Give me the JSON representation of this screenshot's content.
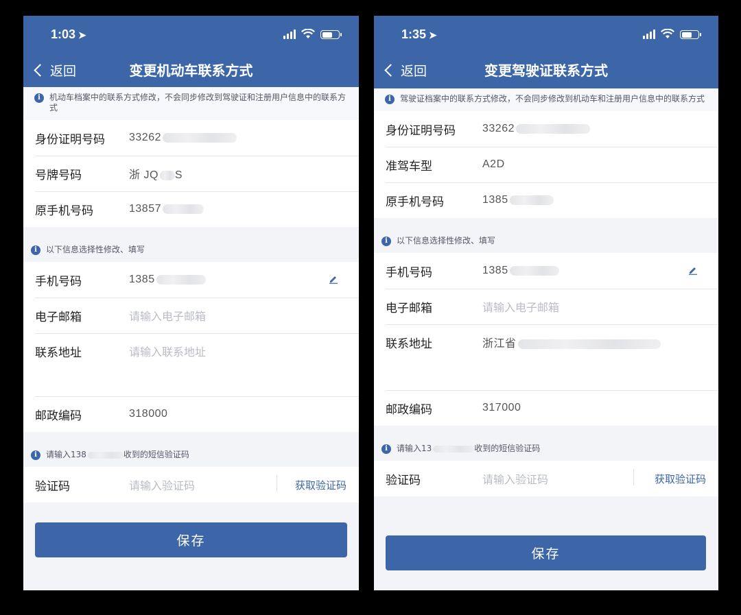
{
  "left": {
    "status": {
      "time": "1:03"
    },
    "nav": {
      "back_label": "返回",
      "title": "变更机动车联系方式"
    },
    "notice_top": "机动车档案中的联系方式修改，不会同步修改到驾驶证和注册用户信息中的联系方式",
    "fixed_rows": [
      {
        "label": "身份证明号码",
        "value": "33262"
      },
      {
        "label": "号牌号码",
        "value": "浙 JQ",
        "suffix": "S"
      },
      {
        "label": "原手机号码",
        "value": "13857"
      }
    ],
    "notice_optional": "以下信息选择性修改、填写",
    "phone": {
      "label": "手机号码",
      "value": "1385"
    },
    "email": {
      "label": "电子邮箱",
      "placeholder": "请输入电子邮箱"
    },
    "address": {
      "label": "联系地址",
      "placeholder": "请输入联系地址"
    },
    "postcode": {
      "label": "邮政编码",
      "value": "318000"
    },
    "notice_sms": {
      "prefix": "请输入138",
      "suffix": "收到的短信验证码"
    },
    "code": {
      "label": "验证码",
      "placeholder": "请输入验证码",
      "get_code": "获取验证码"
    },
    "save_label": "保存"
  },
  "right": {
    "status": {
      "time": "1:35"
    },
    "nav": {
      "back_label": "返回",
      "title": "变更驾驶证联系方式"
    },
    "notice_top": "驾驶证档案中的联系方式修改，不会同步修改到机动车和注册用户信息中的联系方式",
    "fixed_rows": [
      {
        "label": "身份证明号码",
        "value": "33262"
      },
      {
        "label": "准驾车型",
        "value": "A2D"
      },
      {
        "label": "原手机号码",
        "value": "1385"
      }
    ],
    "notice_optional": "以下信息选择性修改、填写",
    "phone": {
      "label": "手机号码",
      "value": "1385"
    },
    "email": {
      "label": "电子邮箱",
      "placeholder": "请输入电子邮箱"
    },
    "address": {
      "label": "联系地址",
      "value": "浙江省"
    },
    "postcode": {
      "label": "邮政编码",
      "value": "317000"
    },
    "notice_sms": {
      "prefix": "请输入13",
      "suffix": "收到的短信验证码"
    },
    "code": {
      "label": "验证码",
      "placeholder": "请输入验证码",
      "get_code": "获取验证码"
    },
    "save_label": "保存"
  },
  "colors": {
    "primary": "#3c66a8",
    "background": "#f3f4f8",
    "placeholder": "#b9bcc3"
  }
}
